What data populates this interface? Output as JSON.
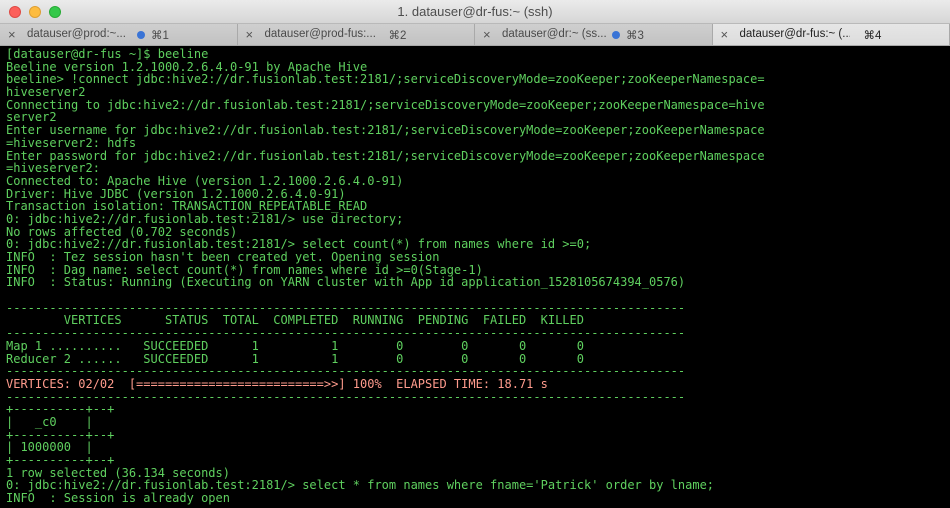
{
  "window": {
    "title": "1. datauser@dr-fus:~ (ssh)"
  },
  "tabs": [
    {
      "label": "datauser@prod:~...",
      "shortcut": "⌘1",
      "dot": true,
      "active": false
    },
    {
      "label": "datauser@prod-fus:...",
      "shortcut": "⌘2",
      "dot": false,
      "active": false
    },
    {
      "label": "datauser@dr:~ (ss...",
      "shortcut": "⌘3",
      "dot": true,
      "active": false
    },
    {
      "label": "datauser@dr-fus:~ (...",
      "shortcut": "⌘4",
      "dot": false,
      "active": true
    }
  ],
  "colors": {
    "terminal_text": "#5fd05f",
    "progress_line": "#ff9b8d",
    "background": "#000000",
    "tab_dot": "#3a74d6"
  },
  "terminal": {
    "lines": [
      "[datauser@dr-fus ~]$ beeline",
      "Beeline version 1.2.1000.2.6.4.0-91 by Apache Hive",
      "beeline> !connect jdbc:hive2://dr.fusionlab.test:2181/;serviceDiscoveryMode=zooKeeper;zooKeeperNamespace=",
      "hiveserver2",
      "Connecting to jdbc:hive2://dr.fusionlab.test:2181/;serviceDiscoveryMode=zooKeeper;zooKeeperNamespace=hive",
      "server2",
      "Enter username for jdbc:hive2://dr.fusionlab.test:2181/;serviceDiscoveryMode=zooKeeper;zooKeeperNamespace",
      "=hiveserver2: hdfs",
      "Enter password for jdbc:hive2://dr.fusionlab.test:2181/;serviceDiscoveryMode=zooKeeper;zooKeeperNamespace",
      "=hiveserver2:",
      "Connected to: Apache Hive (version 1.2.1000.2.6.4.0-91)",
      "Driver: Hive JDBC (version 1.2.1000.2.6.4.0-91)",
      "Transaction isolation: TRANSACTION_REPEATABLE_READ",
      "0: jdbc:hive2://dr.fusionlab.test:2181/> use directory;",
      "No rows affected (0.702 seconds)",
      "0: jdbc:hive2://dr.fusionlab.test:2181/> select count(*) from names where id >=0;",
      "INFO  : Tez session hasn't been created yet. Opening session",
      "INFO  : Dag name: select count(*) from names where id >=0(Stage-1)",
      "INFO  : Status: Running (Executing on YARN cluster with App id application_1528105674394_0576)",
      "",
      "----------------------------------------------------------------------------------------------",
      "        VERTICES      STATUS  TOTAL  COMPLETED  RUNNING  PENDING  FAILED  KILLED",
      "----------------------------------------------------------------------------------------------",
      "Map 1 ..........   SUCCEEDED      1          1        0        0       0       0",
      "Reducer 2 ......   SUCCEEDED      1          1        0        0       0       0",
      "----------------------------------------------------------------------------------------------",
      "VERTICES: 02/02  [==========================>>] 100%  ELAPSED TIME: 18.71 s",
      "----------------------------------------------------------------------------------------------",
      "+----------+--+",
      "|   _c0    |",
      "+----------+--+",
      "| 1000000  |",
      "+----------+--+",
      "1 row selected (36.134 seconds)",
      "0: jdbc:hive2://dr.fusionlab.test:2181/> select * from names where fname='Patrick' order by lname;",
      "INFO  : Session is already open"
    ],
    "highlight_line_index": 26
  }
}
